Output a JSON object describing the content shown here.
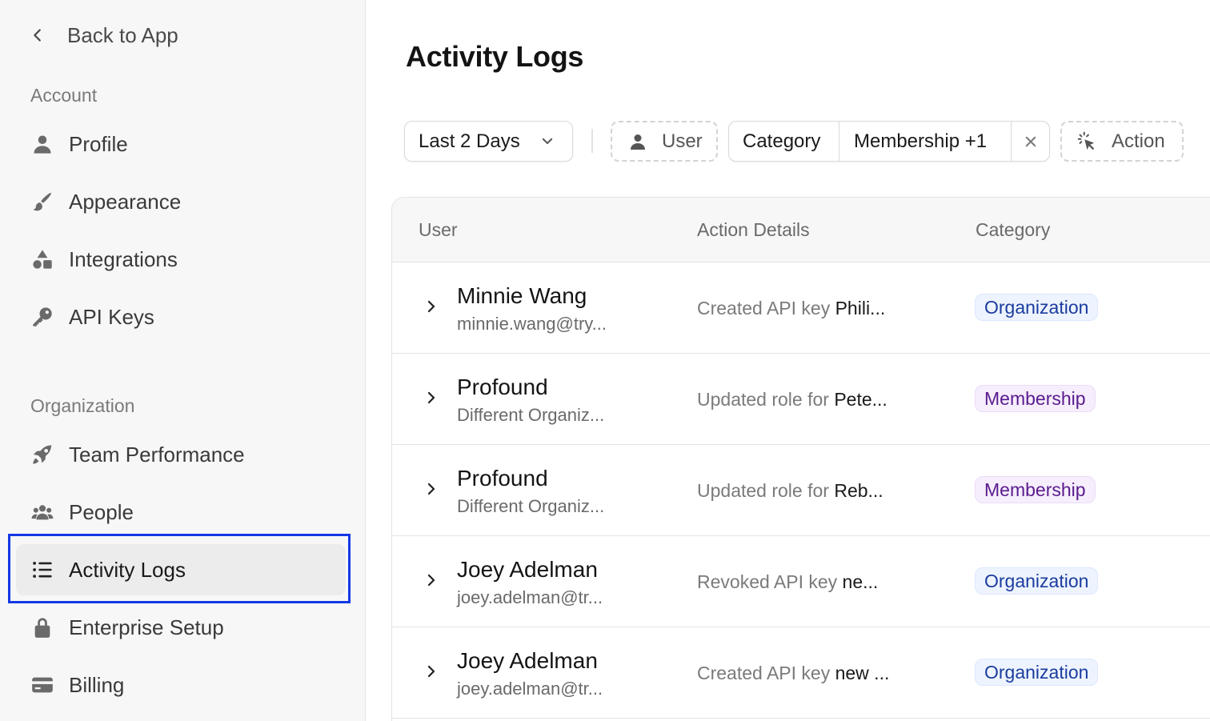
{
  "sidebar": {
    "back_label": "Back to App",
    "account_label": "Account",
    "organization_label": "Organization",
    "account_items": [
      {
        "label": "Profile",
        "icon": "user-icon"
      },
      {
        "label": "Appearance",
        "icon": "brush-icon"
      },
      {
        "label": "Integrations",
        "icon": "shapes-icon"
      },
      {
        "label": "API Keys",
        "icon": "key-icon"
      }
    ],
    "org_items": [
      {
        "label": "Team Performance",
        "icon": "rocket-icon"
      },
      {
        "label": "People",
        "icon": "people-icon"
      },
      {
        "label": "Activity Logs",
        "icon": "list-icon",
        "active": true
      },
      {
        "label": "Enterprise Setup",
        "icon": "lock-icon"
      },
      {
        "label": "Billing",
        "icon": "card-icon"
      }
    ]
  },
  "main": {
    "title": "Activity Logs",
    "filters": {
      "date": "Last 2 Days",
      "user": "User",
      "category_label": "Category",
      "category_value": "Membership +1",
      "action": "Action"
    },
    "table": {
      "columns": [
        "User",
        "Action Details",
        "Category"
      ],
      "rows": [
        {
          "name": "Minnie Wang",
          "sub": "minnie.wang@try...",
          "detail_prefix": "Created API key ",
          "detail_bold": "Phili...",
          "category": "Organization"
        },
        {
          "name": "Profound",
          "sub": "Different Organiz...",
          "detail_prefix": "Updated role for ",
          "detail_bold": "Pete...",
          "category": "Membership"
        },
        {
          "name": "Profound",
          "sub": "Different Organiz...",
          "detail_prefix": "Updated role for ",
          "detail_bold": "Reb...",
          "category": "Membership"
        },
        {
          "name": "Joey Adelman",
          "sub": "joey.adelman@tr...",
          "detail_prefix": "Revoked API key ",
          "detail_bold": "ne...",
          "category": "Organization"
        },
        {
          "name": "Joey Adelman",
          "sub": "joey.adelman@tr...",
          "detail_prefix": "Created API key ",
          "detail_bold": "new ...",
          "category": "Organization"
        }
      ]
    }
  },
  "colors": {
    "focus_ring": "#1438e6",
    "org_badge_text": "#1a3c9e",
    "membership_badge_text": "#5a1a8e"
  }
}
